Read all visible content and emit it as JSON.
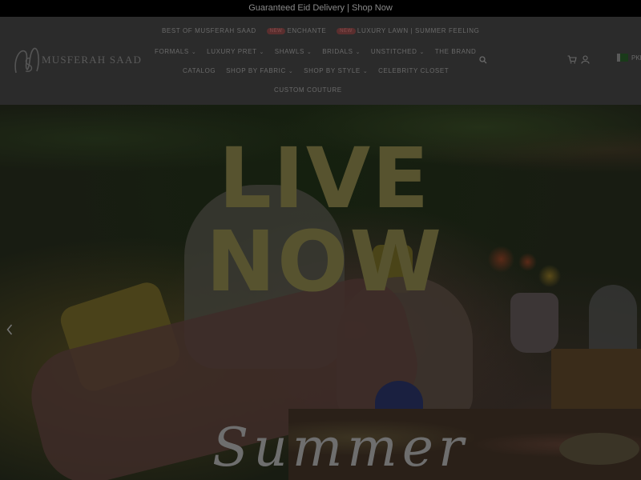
{
  "announcement": "Guaranteed Eid Delivery | Shop Now",
  "brand": {
    "name": "MUSFERAH SAAD"
  },
  "nav": {
    "row1": [
      {
        "label": "BEST OF MUSFERAH SAAD"
      },
      {
        "badge": "NEW",
        "label": "ENCHANTE"
      },
      {
        "badge": "NEW",
        "label": "LUXURY LAWN | SUMMER FEELING"
      }
    ],
    "row2": [
      "FORMALS",
      "LUXURY PRET",
      "SHAWLS",
      "BRIDALS",
      "UNSTITCHED",
      "THE BRAND"
    ],
    "row3": [
      "CATALOG",
      "SHOP BY FABRIC",
      "SHOP BY STYLE",
      "CELEBRITY CLOSET"
    ],
    "row4": [
      "CUSTOM COUTURE"
    ]
  },
  "currency": "PKR",
  "hero": {
    "headline": "LIVE NOW",
    "script": "Summer"
  },
  "icons": [
    "search-icon",
    "cart-icon",
    "account-icon",
    "flag-icon",
    "chevron-left-icon"
  ],
  "colors": {
    "announcement_bg": "#000000",
    "header_bg": "#2b2b2b",
    "headline": "#57532f"
  }
}
